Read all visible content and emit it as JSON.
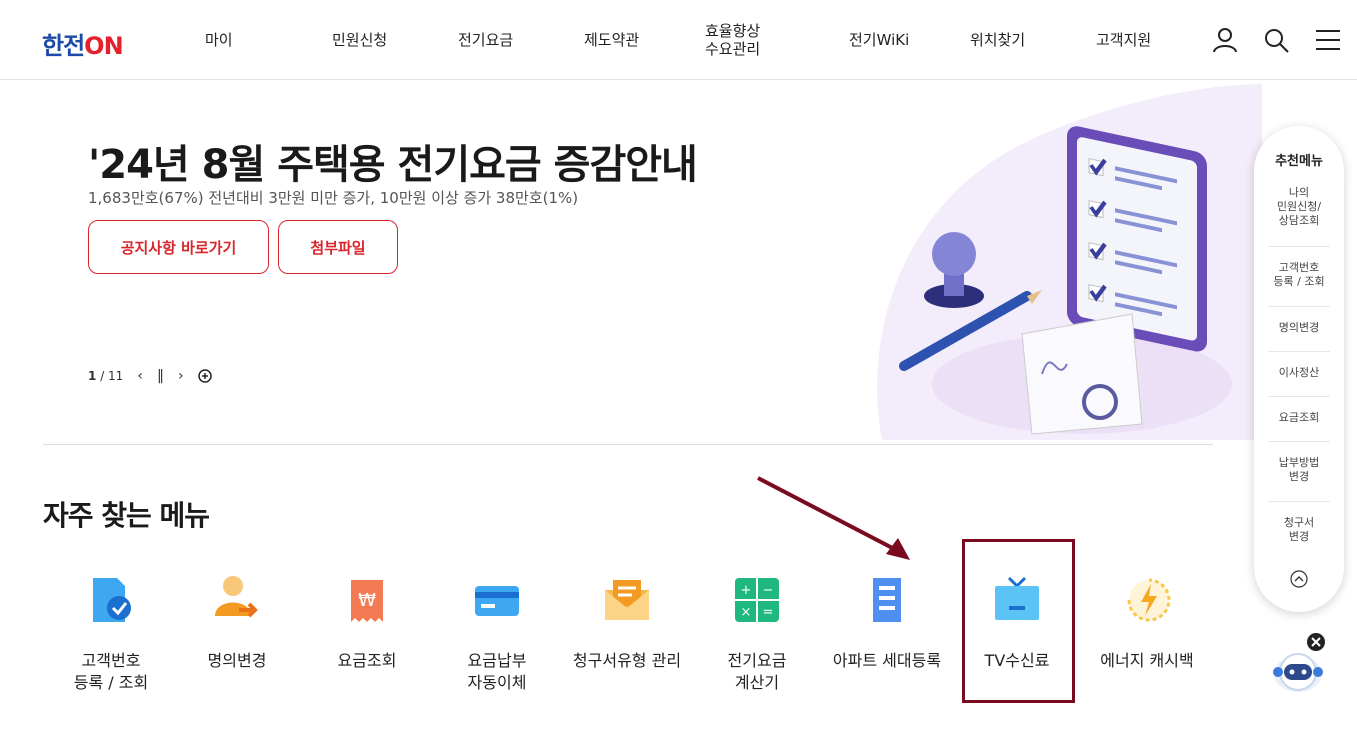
{
  "header": {
    "logo_main": "한전",
    "logo_on": "ON",
    "nav": [
      "마이",
      "민원신청",
      "전기요금",
      "제도약관",
      "효율향상",
      "수요관리",
      "전기WiKi",
      "위치찾기",
      "고객지원"
    ],
    "icons": [
      "user-icon",
      "search-icon",
      "menu-icon"
    ]
  },
  "banner": {
    "title": "'24년 8월 주택용 전기요금 증감안내",
    "subtitle": "1,683만호(67%) 전년대비 3만원 미만 증가, 10만원 이상 증가 38만호(1%)",
    "button_notice": "공지사항 바로가기",
    "button_attachment": "첨부파일",
    "pager_current": "1",
    "pager_total": "/ 11"
  },
  "frequent_menu": {
    "title": "자주 찾는 메뉴",
    "items": [
      {
        "line1": "고객번호",
        "line2": "등록 / 조회",
        "icon": "document-check-icon"
      },
      {
        "line1": "명의변경",
        "line2": "",
        "icon": "person-transfer-icon"
      },
      {
        "line1": "요금조회",
        "line2": "",
        "icon": "receipt-won-icon"
      },
      {
        "line1": "요금납부",
        "line2": "자동이체",
        "icon": "credit-card-icon"
      },
      {
        "line1": "청구서유형 관리",
        "line2": "",
        "icon": "envelope-icon"
      },
      {
        "line1": "전기요금",
        "line2": "계산기",
        "icon": "calculator-icon"
      },
      {
        "line1": "아파트 세대등록",
        "line2": "",
        "icon": "apartment-icon"
      },
      {
        "line1": "TV수신료",
        "line2": "",
        "icon": "tv-icon"
      },
      {
        "line1": "에너지 캐시백",
        "line2": "",
        "icon": "energy-cashback-icon"
      }
    ]
  },
  "recommend": {
    "title": "추천메뉴",
    "items": [
      [
        "나의",
        "민원신청/",
        "상담조회"
      ],
      [
        "고객번호",
        "등록 / 조회"
      ],
      [
        "명의변경"
      ],
      [
        "이사정산"
      ],
      [
        "요금조회"
      ],
      [
        "납부방법",
        "변경"
      ],
      [
        "청구서",
        "변경"
      ]
    ]
  },
  "colors": {
    "accent_red": "#d9262c",
    "logo_blue": "#1d4aa8",
    "highlight": "#7a0a1f"
  }
}
